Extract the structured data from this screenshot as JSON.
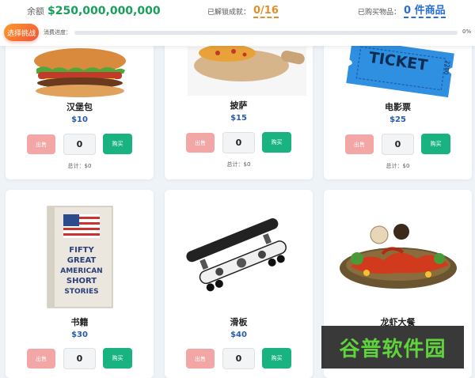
{
  "header": {
    "balance_label": "余额",
    "balance_value": "$250,000,000,000",
    "achievements_label": "已解锁成就：",
    "achievements_value": "0/16",
    "bought_label": "已购买物品：",
    "bought_value": "0 件商品"
  },
  "challenge": {
    "button_label": "选择挑战",
    "progress_label": "消费进度：",
    "progress_percent": "0%",
    "progress_fraction": 0
  },
  "colors": {
    "balance": "#18a05a",
    "achievements": "#e0902b",
    "bought": "#2a6fd0",
    "price": "#2a5ca8",
    "sell_button": "#f2a6a6",
    "buy_button": "#19b381"
  },
  "products": [
    {
      "name": "汉堡包",
      "price": "$10",
      "sell_label": "出售",
      "qty": "0",
      "buy_label": "购买",
      "total": "总计：$0",
      "icon": "hamburger-image"
    },
    {
      "name": "披萨",
      "price": "$15",
      "sell_label": "出售",
      "qty": "0",
      "buy_label": "购买",
      "total": "总计：$0",
      "icon": "pizza-image"
    },
    {
      "name": "电影票",
      "price": "$25",
      "sell_label": "出售",
      "qty": "0",
      "buy_label": "购买",
      "total": "总计：$0",
      "icon": "movie-ticket-image",
      "ticket_text": "TICKET",
      "ticket_number": "2280"
    },
    {
      "name": "书籍",
      "price": "$30",
      "sell_label": "出售",
      "qty": "0",
      "buy_label": "购买",
      "icon": "book-image",
      "book_title": "FIFTY GREAT AMERICAN SHORT STORIES",
      "book_title_lines": [
        "FIFTY",
        "GREAT",
        "AMERICAN",
        "SHORT",
        "STORIES"
      ]
    },
    {
      "name": "滑板",
      "price": "$40",
      "sell_label": "出售",
      "qty": "0",
      "buy_label": "购买",
      "icon": "skateboard-image"
    },
    {
      "name": "龙虾大餐",
      "icon": "lobster-dinner-image"
    }
  ],
  "watermark": "谷普软件园"
}
